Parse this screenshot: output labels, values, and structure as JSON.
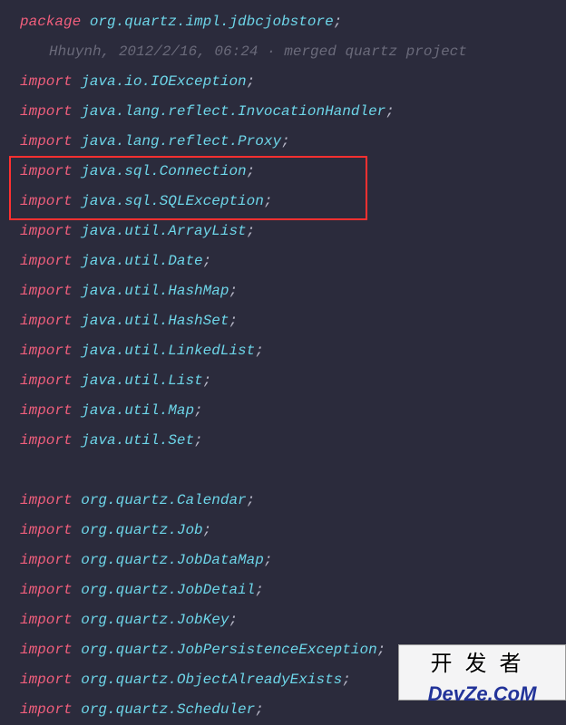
{
  "keywords": {
    "package": "package",
    "import": "import"
  },
  "punct": {
    "semi": ";"
  },
  "package_decl": "org.quartz.impl.jdbcjobstore",
  "blame": "Hhuynh, 2012/2/16, 06:24 · merged quartz project",
  "imports": [
    "java.io.IOException",
    "java.lang.reflect.InvocationHandler",
    "java.lang.reflect.Proxy",
    "java.sql.Connection",
    "java.sql.SQLException",
    "java.util.ArrayList",
    "java.util.Date",
    "java.util.HashMap",
    "java.util.HashSet",
    "java.util.LinkedList",
    "java.util.List",
    "java.util.Map",
    "java.util.Set"
  ],
  "imports_group2": [
    "org.quartz.Calendar",
    "org.quartz.Job",
    "org.quartz.JobDataMap",
    "org.quartz.JobDetail",
    "org.quartz.JobKey",
    "org.quartz.JobPersistenceException",
    "org.quartz.ObjectAlreadyExists",
    "org.quartz.Scheduler"
  ],
  "watermark": {
    "cn": "开发者",
    "url": "DevZe.CoM"
  }
}
